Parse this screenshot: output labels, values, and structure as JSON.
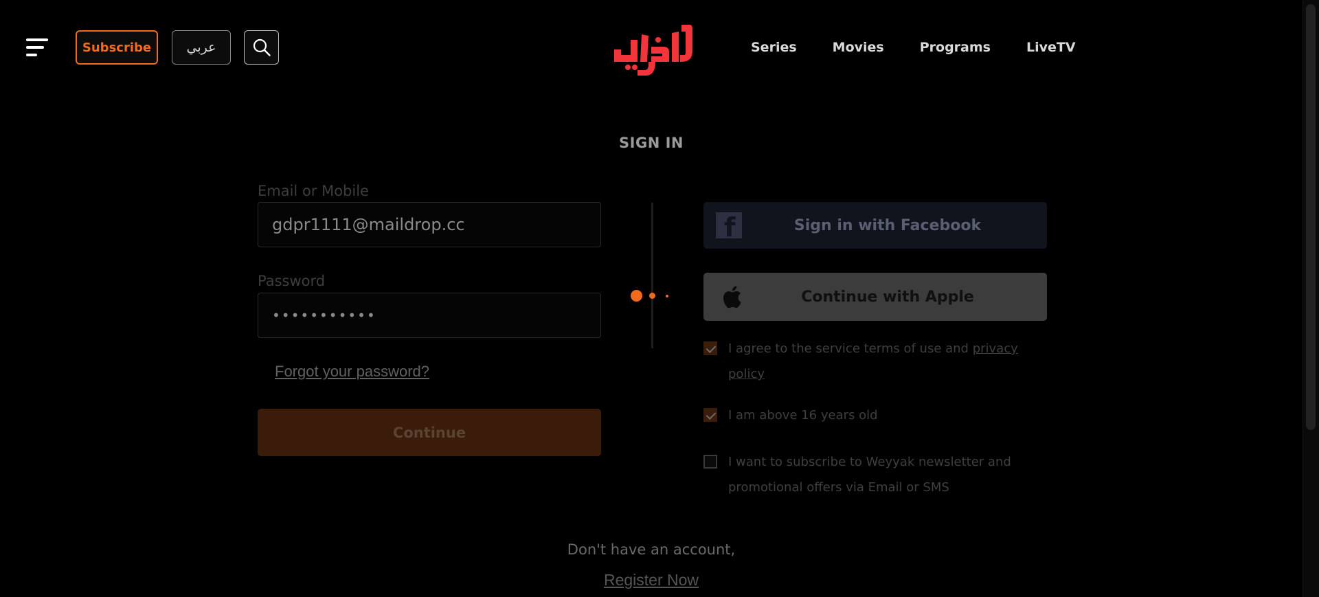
{
  "header": {
    "subscribe_label": "Subscribe",
    "language_label": "عربي",
    "logo_text": "وياك",
    "nav": [
      "Series",
      "Movies",
      "Programs",
      "LiveTV"
    ]
  },
  "signin": {
    "title": "SIGN IN",
    "email_label": "Email or Mobile",
    "email_value": "gdpr1111@maildrop.cc",
    "password_label": "Password",
    "password_value": "•••••••••••",
    "forgot_label": "Forgot your password?",
    "continue_label": "Continue",
    "facebook_label": "Sign in with Facebook",
    "apple_label": "Continue with Apple"
  },
  "consents": [
    {
      "text": "I agree to the service terms of use and",
      "link": "privacy policy",
      "checked": true
    },
    {
      "text": "I am above 16 years old",
      "checked": true
    },
    {
      "text": "I want to subscribe to Weyyak newsletter and promotional offers via Email or SMS",
      "checked": false
    }
  ],
  "footer": {
    "no_account": "Don't have an account,",
    "register_label": "Register Now"
  },
  "colors": {
    "accent": "#f26b1d",
    "background": "#000000"
  },
  "icons": [
    "menu-icon",
    "search-icon",
    "facebook-icon",
    "apple-icon",
    "checkmark-icon",
    "loading-dots"
  ]
}
